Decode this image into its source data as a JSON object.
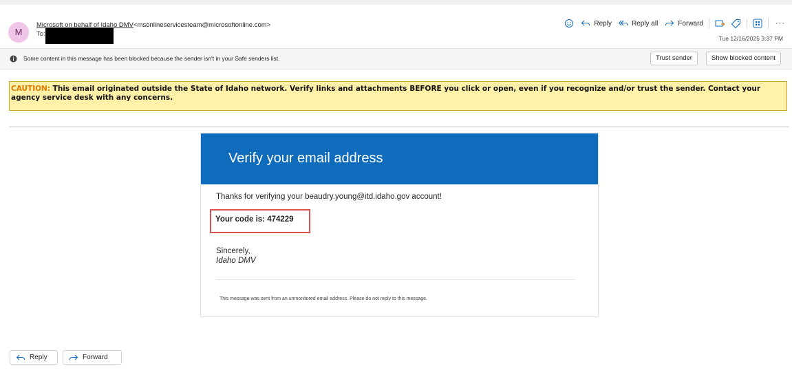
{
  "header": {
    "avatar_initial": "M",
    "sender_name": "Microsoft on behalf of Idaho DMV",
    "sender_email": "<msonlineservicesteam@microsoftonline.com>",
    "to_label": "To:",
    "datetime": "Tue 12/16/2025 3:37 PM",
    "actions": {
      "reply": "Reply",
      "reply_all": "Reply all",
      "forward": "Forward",
      "more": "···"
    }
  },
  "blocked_bar": {
    "message": "Some content in this message has been blocked because the sender isn't in your Safe senders list.",
    "trust_sender": "Trust sender",
    "show_blocked": "Show blocked content"
  },
  "caution": {
    "label": "CAUTION:",
    "text": " This email originated outside the State of Idaho network. Verify links and attachments BEFORE you click or open, even if you recognize and/or trust the sender. Contact your agency service desk with any concerns."
  },
  "email": {
    "title": "Verify your email address",
    "thanks": "Thanks for verifying your beaudry.young@itd.idaho.gov account!",
    "code_line": "Your code is: 474229",
    "sincerely": "Sincerely,",
    "signer": "Idaho DMV",
    "footer_note": "This message was sent from an unmonitored email address. Please do not reply to this message."
  },
  "footer_buttons": {
    "reply": "Reply",
    "forward": "Forward"
  },
  "colors": {
    "brand_blue": "#0f6cbd",
    "caution_bg": "#fff2a8",
    "caution_label": "#e07a00",
    "highlight_box": "#d9534f",
    "avatar_bg": "#f0c6e8"
  }
}
